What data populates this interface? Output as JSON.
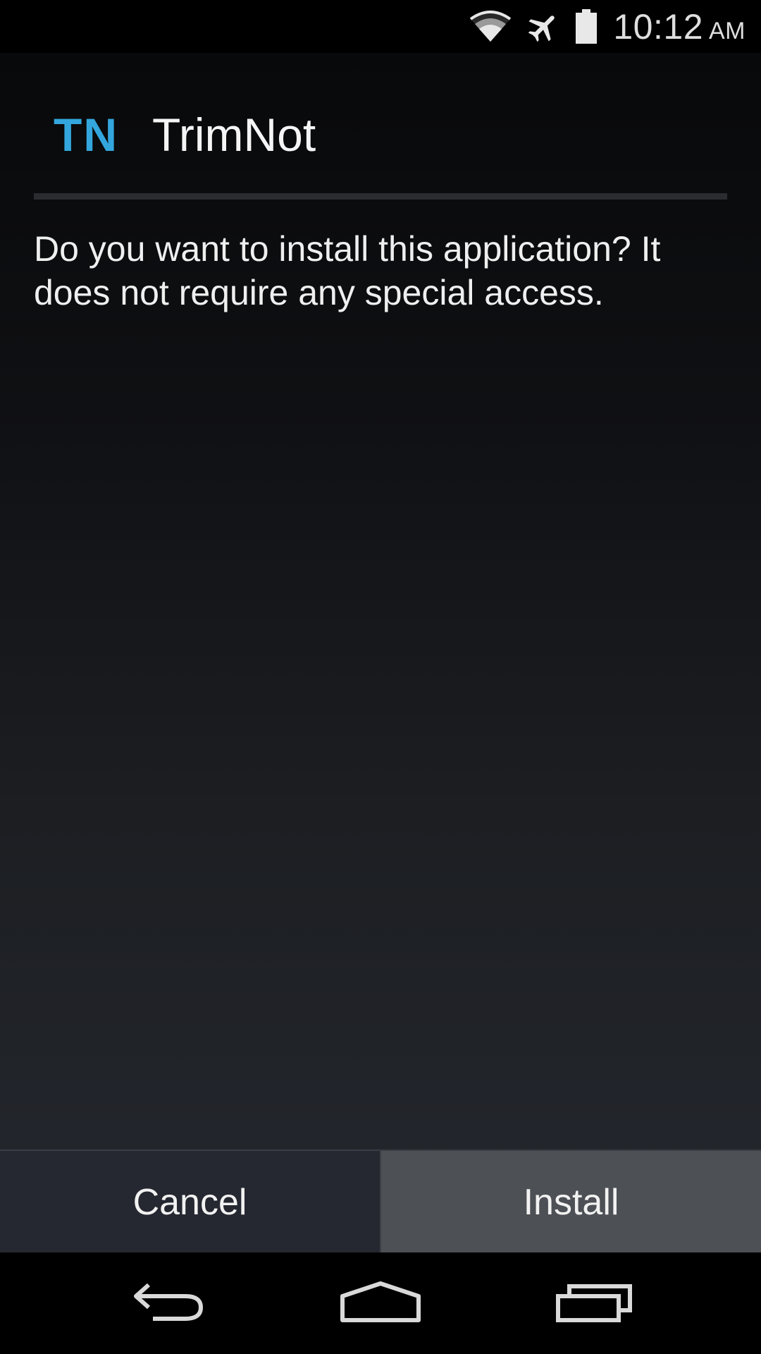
{
  "status_bar": {
    "time": "10:12",
    "ampm": "AM",
    "icons": [
      "wifi-icon",
      "airplane-mode-icon",
      "battery-icon"
    ]
  },
  "dialog": {
    "app_icon_text": "TN",
    "app_name": "TrimNot",
    "message": "Do you want to install this application? It does not require any special access."
  },
  "buttons": {
    "cancel_label": "Cancel",
    "install_label": "Install"
  },
  "nav_bar": {
    "icons": [
      "back-icon",
      "home-icon",
      "recent-apps-icon"
    ]
  },
  "colors": {
    "accent": "#33a6dd",
    "install_button_bg": "#4d5055",
    "cancel_button_bg": "#252830"
  }
}
